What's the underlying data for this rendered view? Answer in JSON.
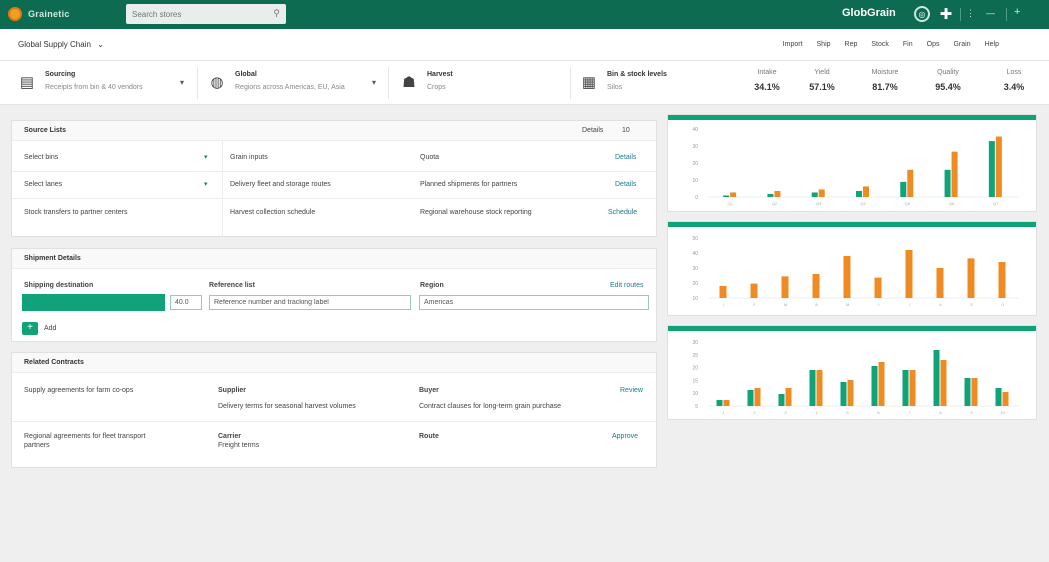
{
  "app": {
    "logo_text": "Grainetic",
    "search_placeholder": "Search stores",
    "brand": "GlobGrain",
    "toolbar_extra": "—"
  },
  "subheader": {
    "workspace": "Global Supply Chain",
    "nav": [
      "Import",
      "Ship",
      "Rep",
      "Stock",
      "Fin",
      "Ops",
      "Grain",
      "Help"
    ]
  },
  "summary": {
    "items": [
      {
        "title": "Sourcing",
        "sub": "Receipts from bin & 40 vendors"
      },
      {
        "title": "Global",
        "sub": "Regions across Americas, EU, Asia"
      },
      {
        "title": "Harvest",
        "sub": "Crops"
      },
      {
        "title": "Bin & stock levels",
        "sub": "Silos"
      }
    ],
    "metrics": [
      {
        "label": "Intake",
        "value": "34.1%"
      },
      {
        "label": "Yield",
        "value": "57.1%"
      },
      {
        "label": "Moisture",
        "value": "81.7%"
      },
      {
        "label": "Quality",
        "value": "95.4%"
      },
      {
        "label": "Loss",
        "value": "3.4%"
      }
    ]
  },
  "panel1": {
    "title": "Source Lists",
    "header_action": "Details",
    "header_count": "10",
    "rows": [
      {
        "a": "Select bins",
        "b": "Grain inputs",
        "c": "Quota",
        "d": "Details"
      },
      {
        "a": "Select lanes",
        "b": "Delivery fleet and storage routes",
        "c": "Planned shipments for partners",
        "d": "Details"
      },
      {
        "a": "Stock transfers to partner centers",
        "b": "Harvest collection schedule",
        "c": "Regional warehouse stock reporting",
        "d": "Schedule"
      }
    ]
  },
  "panel2": {
    "title": "Shipment Details",
    "col1_label": "Shipping destination",
    "col2_label": "Reference list",
    "col3_label": "Region",
    "col3_action": "Edit routes",
    "qty_value": "40.0",
    "reference_value": "Reference number and tracking label",
    "region_value": "Americas",
    "add_label": "Add"
  },
  "panel3": {
    "title": "Related Contracts",
    "rows": [
      {
        "a": "Supply agreements for farm co-ops",
        "b_title": "Supplier",
        "b_sub": "Delivery terms for seasonal harvest volumes",
        "c_title": "Buyer",
        "c_sub": "Contract clauses for long-term grain purchase",
        "d": "Review"
      },
      {
        "a": "Regional agreements for fleet transport",
        "a2": "partners",
        "b_title": "Carrier",
        "b_sub": "Freight terms",
        "c_title": "Route",
        "c_sub": "",
        "d": "Approve"
      }
    ]
  },
  "colors": {
    "primary": "#0d6b52",
    "accent_green": "#10a278",
    "accent_orange": "#ef8b22"
  },
  "chart_data": [
    {
      "type": "bar",
      "categories": [
        "Q1",
        "Q2",
        "Q3",
        "Q4",
        "Q5",
        "Q6",
        "Q7"
      ],
      "series": [
        {
          "values": [
            1,
            2,
            3,
            4,
            10,
            18,
            37
          ]
        },
        {
          "values": [
            3,
            4,
            5,
            7,
            18,
            30,
            40
          ]
        }
      ],
      "y_ticks": [
        "40",
        "30",
        "20",
        "10",
        "0"
      ],
      "ylim": [
        0,
        45
      ]
    },
    {
      "type": "bar",
      "categories": [
        "J",
        "F",
        "M",
        "A",
        "M",
        "J",
        "J",
        "A",
        "S",
        "O"
      ],
      "series": [
        {
          "values": [
            10,
            12,
            18,
            20,
            35,
            17,
            40,
            25,
            33,
            30
          ]
        }
      ],
      "y_ticks": [
        "50",
        "40",
        "30",
        "20",
        "10"
      ],
      "ylim": [
        0,
        50
      ]
    },
    {
      "type": "bar",
      "categories": [
        "1",
        "2",
        "3",
        "4",
        "5",
        "6",
        "7",
        "8",
        "9",
        "10"
      ],
      "series": [
        {
          "values": [
            3,
            8,
            6,
            18,
            12,
            20,
            18,
            28,
            14,
            9
          ]
        },
        {
          "values": [
            3,
            9,
            9,
            18,
            13,
            22,
            18,
            23,
            14,
            7
          ]
        }
      ],
      "y_ticks": [
        "30",
        "25",
        "20",
        "15",
        "10",
        "5"
      ],
      "ylim": [
        0,
        32
      ]
    }
  ]
}
